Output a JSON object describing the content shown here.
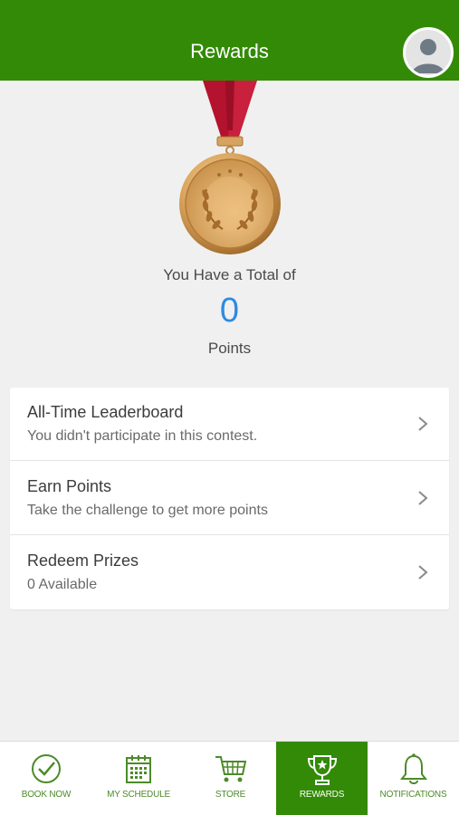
{
  "header": {
    "title": "Rewards",
    "avatar_icon": "user-avatar-icon"
  },
  "medal": {
    "icon": "gold-medal-icon"
  },
  "summary": {
    "total_label": "You Have a Total of",
    "points_value": "0",
    "points_label": "Points"
  },
  "menu": {
    "items": [
      {
        "title": "All-Time Leaderboard",
        "subtitle": "You didn't participate in this contest."
      },
      {
        "title": "Earn Points",
        "subtitle": "Take the challenge to get more points"
      },
      {
        "title": "Redeem Prizes",
        "subtitle": "0 Available"
      }
    ]
  },
  "tabs": [
    {
      "label": "BOOK NOW",
      "icon": "check-circle-icon"
    },
    {
      "label": "MY SCHEDULE",
      "icon": "calendar-icon"
    },
    {
      "label": "STORE",
      "icon": "cart-icon"
    },
    {
      "label": "REWARDS",
      "icon": "trophy-icon",
      "active": true
    },
    {
      "label": "NOTIFICATIONS",
      "icon": "bell-icon"
    }
  ],
  "colors": {
    "brand_green": "#338a06",
    "points_blue": "#2f8ae0",
    "ribbon_red": "#b3132e",
    "medal_gold": "#d9a25a"
  }
}
